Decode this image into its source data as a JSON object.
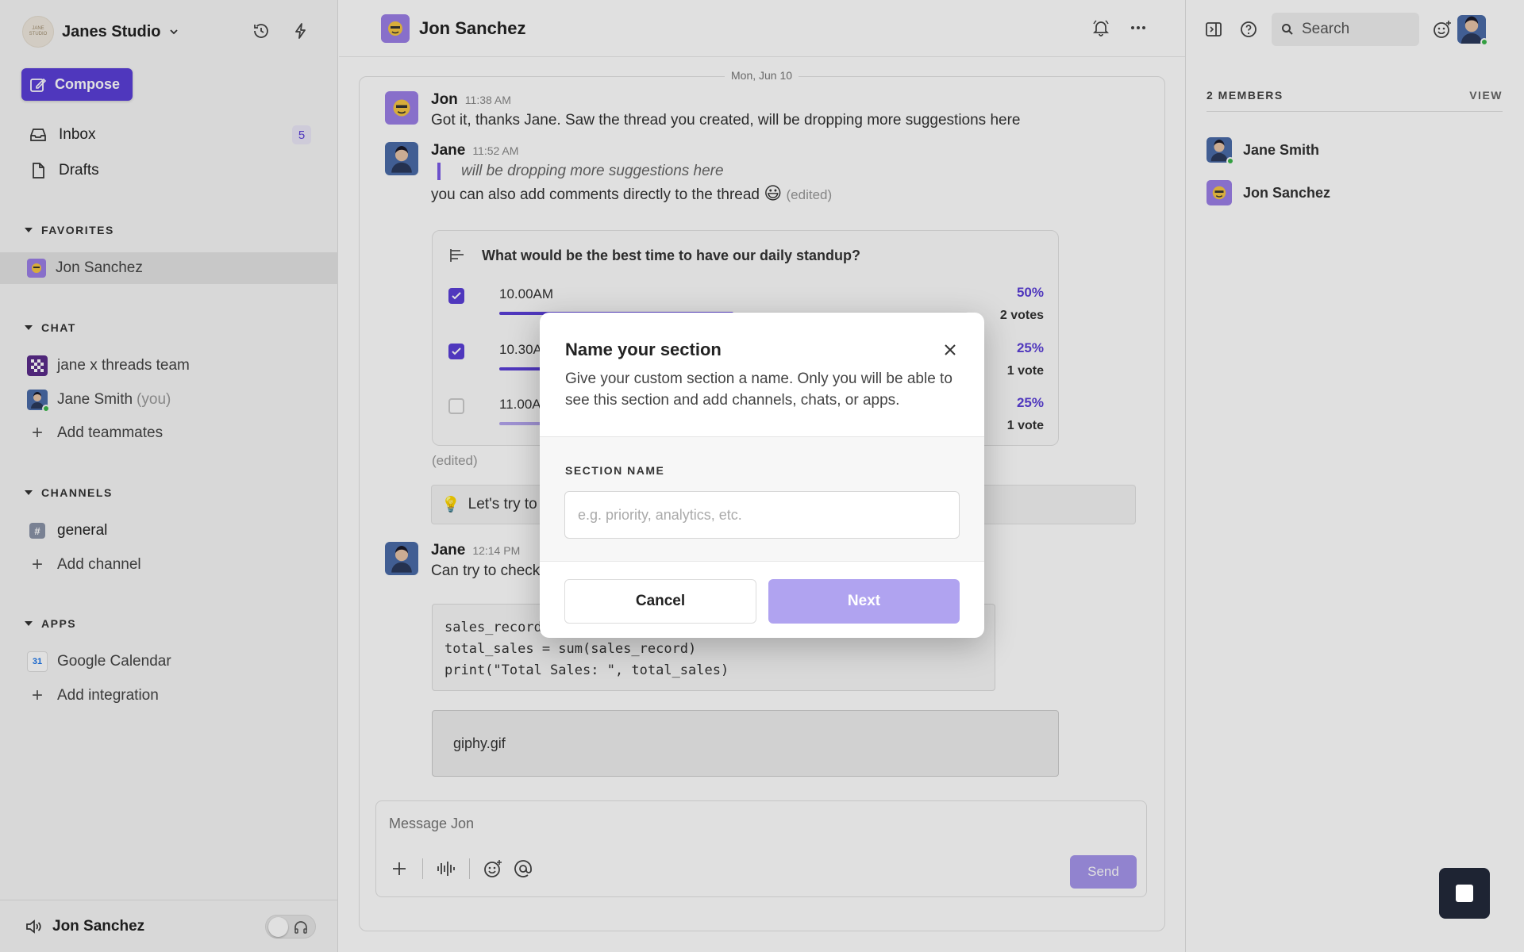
{
  "workspace": {
    "name": "Janes Studio",
    "logo_text": "JANE STUDIO"
  },
  "sidebar": {
    "compose_label": "Compose",
    "nav": [
      {
        "label": "Inbox",
        "badge": "5"
      },
      {
        "label": "Drafts"
      }
    ],
    "favorites": {
      "title": "FAVORITES",
      "items": [
        {
          "label": "Jon Sanchez"
        }
      ]
    },
    "chat": {
      "title": "CHAT",
      "items": [
        {
          "label": "jane x threads team"
        },
        {
          "label": "Jane Smith",
          "suffix": "(you)"
        }
      ],
      "add_label": "Add teammates"
    },
    "channels": {
      "title": "CHANNELS",
      "items": [
        {
          "label": "general"
        }
      ],
      "add_label": "Add channel"
    },
    "apps": {
      "title": "APPS",
      "items": [
        {
          "label": "Google Calendar",
          "icon_text": "31"
        }
      ],
      "add_label": "Add integration"
    },
    "footer": {
      "user": "Jon Sanchez"
    }
  },
  "header": {
    "title": "Jon Sanchez"
  },
  "chat": {
    "date_label": "Mon, Jun 10",
    "messages": [
      {
        "name": "Jon",
        "time": "11:38 AM",
        "text": "Got it, thanks Jane. Saw the thread you created, will be dropping more suggestions here"
      },
      {
        "name": "Jane",
        "time": "11:52 AM",
        "quote": "will be dropping more suggestions here",
        "text": "you can also add comments directly to the thread",
        "emoji": "😃",
        "edited": "(edited)"
      },
      {
        "name": "Jane",
        "time": "12:14 PM",
        "text": "Can try to check"
      }
    ],
    "poll": {
      "question": "What would be the best time to have our daily standup?",
      "options": [
        {
          "label": "10.00AM",
          "percent": "50%",
          "votes": "2 votes",
          "checked": true,
          "fill": 0.5
        },
        {
          "label": "10.30AM",
          "percent": "25%",
          "votes": "1 vote",
          "checked": true,
          "fill": 0.25
        },
        {
          "label": "11.00AM",
          "percent": "25%",
          "votes": "1 vote",
          "checked": false,
          "fill": 0.25
        }
      ],
      "edited": "(edited)"
    },
    "tip": {
      "emoji": "💡",
      "text": "Let's try to"
    },
    "code": "sales_record\ntotal_sales = sum(sales_record)\nprint(\"Total Sales: \", total_sales)",
    "gif_label": "giphy.gif",
    "composer": {
      "placeholder": "Message Jon",
      "send_label": "Send"
    }
  },
  "right_panel": {
    "search_label": "Search",
    "members_title": "2 MEMBERS",
    "view_label": "VIEW",
    "members": [
      {
        "name": "Jane Smith"
      },
      {
        "name": "Jon Sanchez"
      }
    ]
  },
  "modal": {
    "title": "Name your section",
    "description": "Give your custom section a name. Only you will be able to see this section and add channels, chats, or apps.",
    "field_label": "SECTION NAME",
    "field_placeholder": "e.g. priority, analytics, etc.",
    "cancel_label": "Cancel",
    "next_label": "Next"
  },
  "colors": {
    "accent": "#5b3fd8",
    "accent_light": "#b0a3f0",
    "online": "#3bb54a"
  }
}
